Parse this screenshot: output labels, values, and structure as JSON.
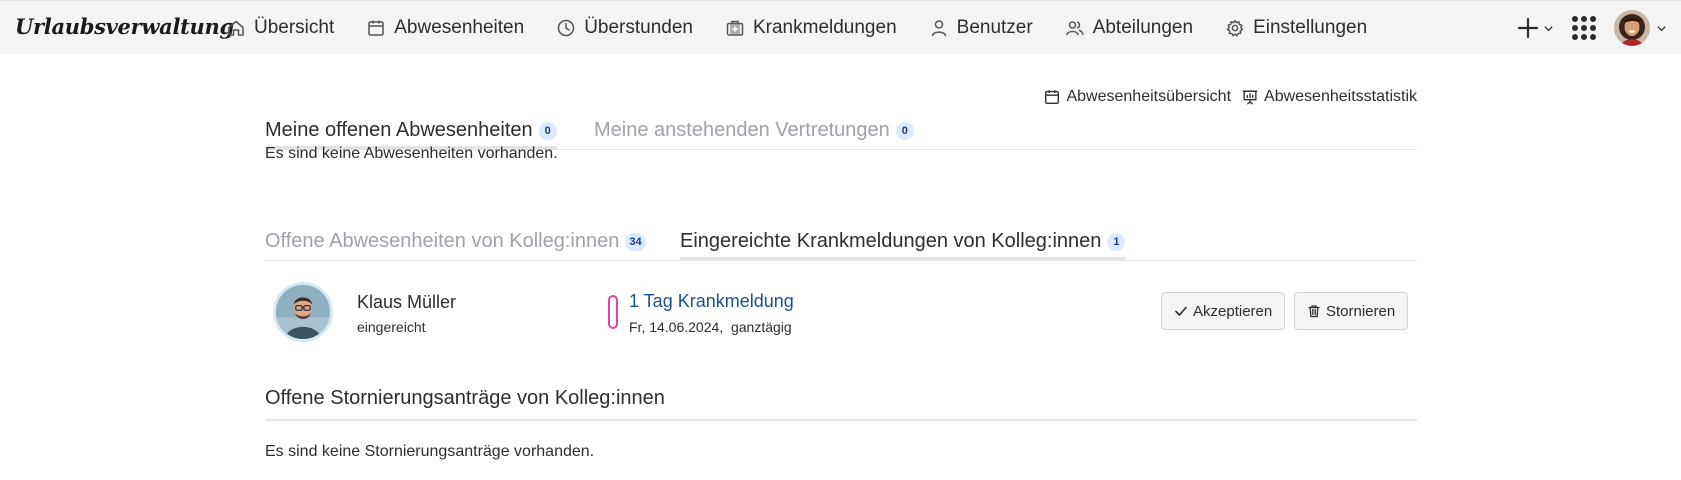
{
  "app": {
    "brand": "Urlaubsverwaltung"
  },
  "nav": {
    "items": [
      {
        "label": "Übersicht",
        "icon": "home-icon"
      },
      {
        "label": "Abwesenheiten",
        "icon": "calendar-icon"
      },
      {
        "label": "Überstunden",
        "icon": "clock-icon"
      },
      {
        "label": "Krankmeldungen",
        "icon": "medical-case-icon"
      },
      {
        "label": "Benutzer",
        "icon": "user-icon"
      },
      {
        "label": "Abteilungen",
        "icon": "users-icon"
      },
      {
        "label": "Einstellungen",
        "icon": "gear-icon"
      }
    ]
  },
  "own_section": {
    "tabs": [
      {
        "label": "Meine offenen Abwesenheiten",
        "count": "0"
      },
      {
        "label": "Meine anstehenden Vertretungen",
        "count": "0"
      }
    ],
    "links": [
      {
        "label": "Abwesenheitsübersicht",
        "icon": "calendar-icon"
      },
      {
        "label": "Abwesenheitsstatistik",
        "icon": "presentation-chart-icon"
      }
    ],
    "empty_text": "Es sind keine Abwesenheiten vorhanden."
  },
  "colleague_section": {
    "tabs": [
      {
        "label": "Offene Abwesenheiten von Kolleg:innen",
        "count": "34"
      },
      {
        "label": "Eingereichte Krankmeldungen von Kolleg:innen",
        "count": "1"
      }
    ],
    "entry": {
      "name": "Klaus Müller",
      "status": "eingereicht",
      "title": "1 Tag Krankmeldung",
      "date": "Fr, 14.06.2024,  ganztägig",
      "accept_label": "Akzeptieren",
      "cancel_label": "Stornieren",
      "marker_color": "#e4439b"
    }
  },
  "cancellation_section": {
    "title": "Offene Stornierungsanträge von Kolleg:innen",
    "empty_text": "Es sind keine Stornierungsanträge vorhanden."
  }
}
